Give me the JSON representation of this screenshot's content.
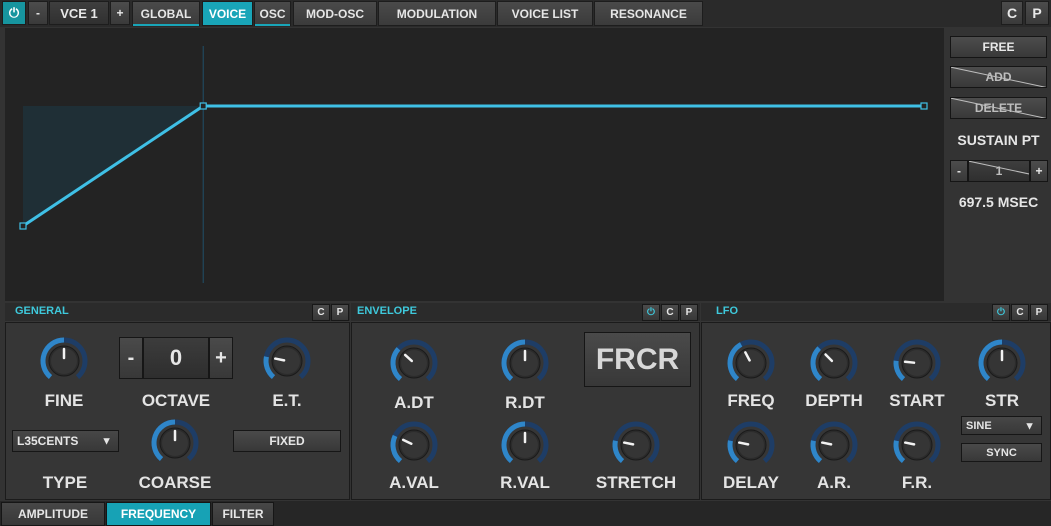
{
  "topbar": {
    "power_icon": "power-icon",
    "voice_minus": "-",
    "voice_name": "VCE 1",
    "voice_plus": "+",
    "tabs": [
      {
        "label": "GLOBAL"
      },
      {
        "label": "VOICE"
      },
      {
        "label": "OSC"
      },
      {
        "label": "MOD-OSC"
      },
      {
        "label": "MODULATION"
      },
      {
        "label": "VOICE LIST"
      },
      {
        "label": "RESONANCE"
      }
    ],
    "active_tab": "VOICE",
    "copy_label": "C",
    "paste_label": "P"
  },
  "envelope_graph": {
    "points": [
      {
        "time_fraction": 0.0,
        "level": 0.0
      },
      {
        "time_fraction": 0.2,
        "level": 0.53
      },
      {
        "time_fraction": 1.0,
        "level": 0.53
      }
    ],
    "sustain_point_index": 1,
    "line_color": "#3fc0e6"
  },
  "right_panel": {
    "free_label": "FREE",
    "add_label": "ADD",
    "delete_label": "DELETE",
    "sustain_label": "SUSTAIN PT",
    "sustain_minus": "-",
    "sustain_value": "1",
    "sustain_plus": "+",
    "time_readout": "697.5 MSEC"
  },
  "general": {
    "title": "GENERAL",
    "copy_label": "C",
    "paste_label": "P",
    "fine_label": "FINE",
    "fine_value": 0.5,
    "octave_label": "OCTAVE",
    "octave_minus": "-",
    "octave_value": "0",
    "octave_plus": "+",
    "et_label": "E.T.",
    "et_value": 0.22,
    "type_value": "L35CENTS",
    "type_label": "TYPE",
    "coarse_label": "COARSE",
    "coarse_value": 0.5,
    "fixed_label": "FIXED"
  },
  "envelope": {
    "title": "ENVELOPE",
    "copy_label": "C",
    "paste_label": "P",
    "adt_label": "A.DT",
    "adt_value": 0.33,
    "rdt_label": "R.DT",
    "rdt_value": 0.5,
    "frcr_label": "FRCR",
    "aval_label": "A.VAL",
    "aval_value": 0.27,
    "rval_label": "R.VAL",
    "rval_value": 0.5,
    "stretch_label": "STRETCH",
    "stretch_value": 0.22
  },
  "lfo": {
    "title": "LFO",
    "copy_label": "C",
    "paste_label": "P",
    "freq_label": "FREQ",
    "freq_value": 0.4,
    "depth_label": "DEPTH",
    "depth_value": 0.34,
    "start_label": "START",
    "start_value": 0.2,
    "str_label": "STR",
    "str_value": 0.5,
    "shape_value": "SINE",
    "sync_label": "SYNC",
    "delay_label": "DELAY",
    "delay_value": 0.22,
    "ar_label": "A.R.",
    "ar_value": 0.22,
    "fr_label": "F.R.",
    "fr_value": 0.22
  },
  "bottom_tabs": [
    {
      "label": "AMPLITUDE"
    },
    {
      "label": "FREQUENCY"
    },
    {
      "label": "FILTER"
    }
  ],
  "active_bottom_tab": "FREQUENCY",
  "colors": {
    "accent": "#19a5b8",
    "knob_arc": "#2f86c9",
    "knob_track": "#1e3d66",
    "title_text": "#3ec9dc"
  }
}
